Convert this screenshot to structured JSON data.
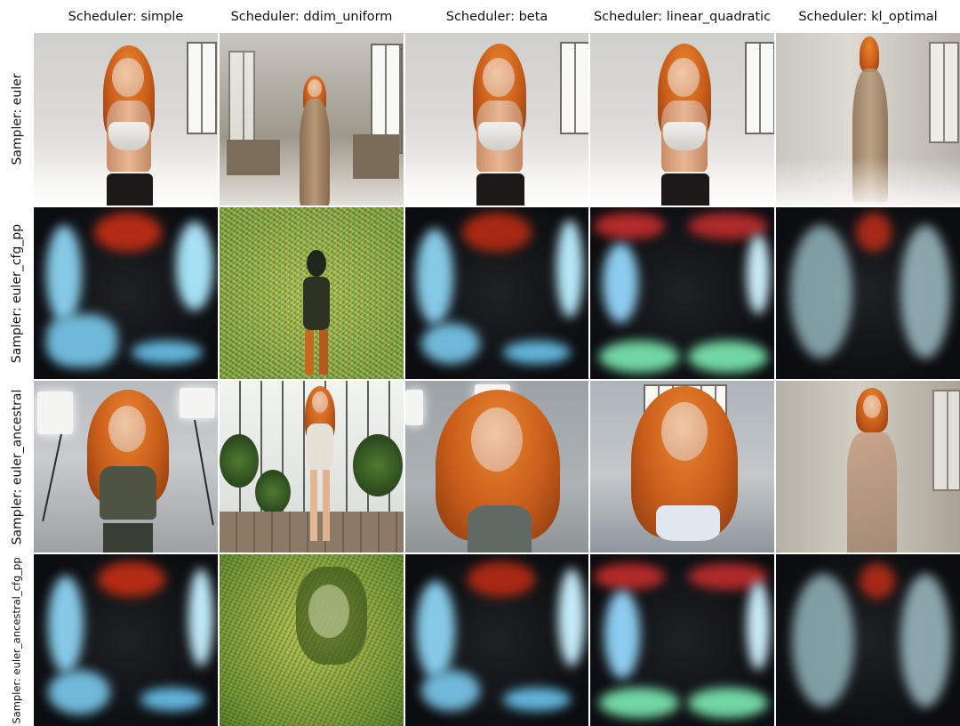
{
  "columns": [
    "Scheduler: simple",
    "Scheduler: ddim_uniform",
    "Scheduler: beta",
    "Scheduler: linear_quadratic",
    "Scheduler: kl_optimal"
  ],
  "rows": [
    "Sampler: euler",
    "Sampler: euler_cfg_pp",
    "Sampler: euler_ancestral",
    "Sampler: euler_ancestral_cfg_pp"
  ],
  "colors": {
    "hair": "#d0661f",
    "noise_green": "#8fa843",
    "cyan_glow": "#7fd3f0",
    "red_glow": "#b52a14",
    "mint_glow": "#72d6a4"
  }
}
